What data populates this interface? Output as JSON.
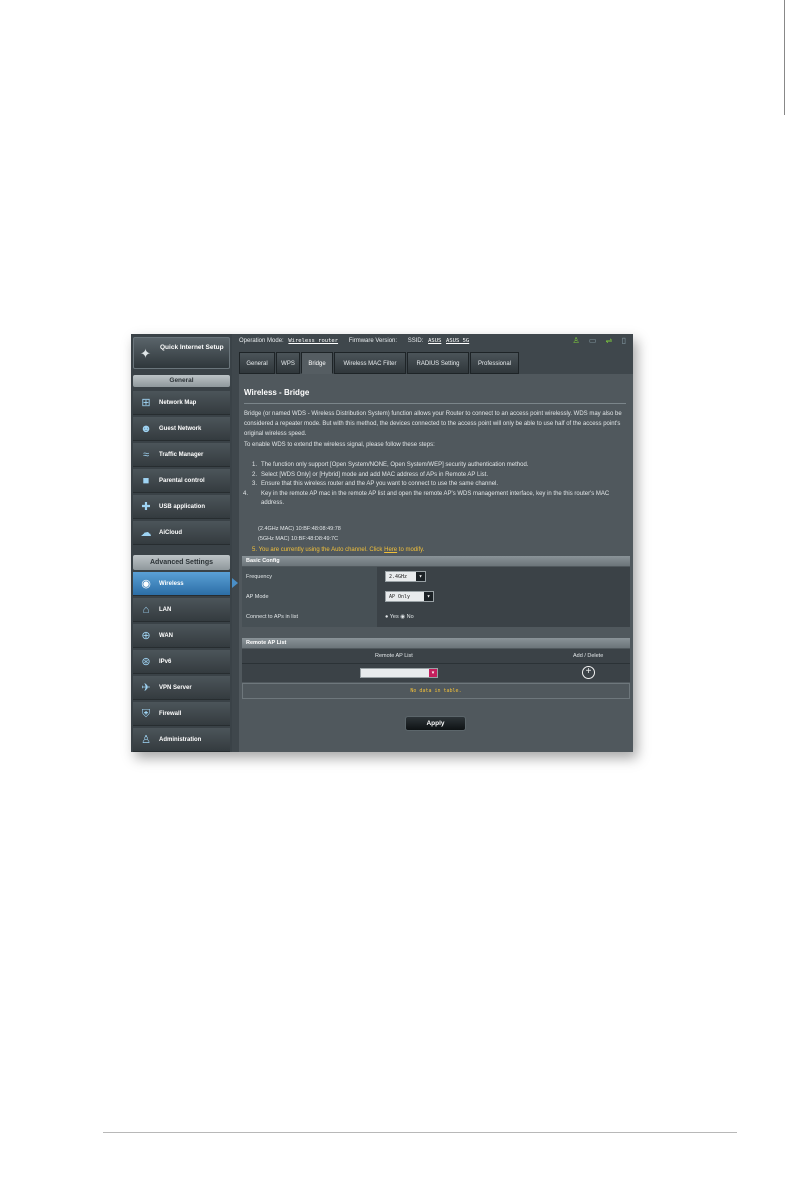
{
  "sidebar": {
    "quick_setup": "Quick Internet Setup",
    "general_header": "General",
    "general_items": [
      {
        "label": "Network Map"
      },
      {
        "label": "Guest Network"
      },
      {
        "label": "Traffic Manager"
      },
      {
        "label": "Parental control"
      },
      {
        "label": "USB application"
      },
      {
        "label": "AiCloud"
      }
    ],
    "advanced_header": "Advanced Settings",
    "advanced_items": [
      {
        "label": "Wireless"
      },
      {
        "label": "LAN"
      },
      {
        "label": "WAN"
      },
      {
        "label": "IPv6"
      },
      {
        "label": "VPN Server"
      },
      {
        "label": "Firewall"
      },
      {
        "label": "Administration"
      }
    ],
    "active_item": "Wireless"
  },
  "topbar": {
    "mode_label": "Operation Mode:",
    "mode_value": "Wireless router",
    "firmware_label": "Firmware Version:",
    "ssid_label": "SSID:",
    "ssid_1": "ASUS",
    "ssid_2": "ASUS_5G"
  },
  "tabs": [
    "General",
    "WPS",
    "Bridge",
    "Wireless MAC Filter",
    "RADIUS Setting",
    "Professional"
  ],
  "active_tab": "Bridge",
  "page": {
    "title": "Wireless - Bridge",
    "description_1": "Bridge (or named WDS - Wireless Distribution System) function allows your Router to connect to an access point wirelessly. WDS may also be considered a repeater mode. But with this method, the devices connected to the access point will only be able to use half of the access point's original wireless speed.",
    "description_2": "To enable WDS to extend the wireless signal, please follow these steps:",
    "steps": [
      {
        "num": "1.",
        "text": "The function only support [Open System/NONE, Open System/WEP] security authentication method."
      },
      {
        "num": "2.",
        "text": "Select [WDS Only] or [Hybrid] mode and add MAC address of APs in Remote AP List."
      },
      {
        "num": "3.",
        "text": "Ensure that this wireless router and the AP you want to connect to use the same channel."
      },
      {
        "num": "4.",
        "text": "Key in the remote AP mac in the remote AP list and open the remote AP's WDS management interface, key in the this router's MAC address."
      }
    ],
    "mac_24": "(2.4GHz MAC) 10:BF:48:08:49:78",
    "mac_5": "(5GHz MAC) 10:BF:48:D8:49:7C",
    "note_num": "5.",
    "note_pre": "You are currently using the Auto channel. Click",
    "note_link": "Here",
    "note_post": "to modify."
  },
  "basic_config": {
    "header": "Basic Config",
    "frequency_label": "Frequency",
    "frequency_value": "2.4GHz",
    "ap_mode_label": "AP Mode",
    "ap_mode_value": "AP Only",
    "connect_label": "Connect to APs in list",
    "yes_label": "Yes",
    "no_label": "No",
    "connect_value": "No"
  },
  "remote_ap": {
    "header": "Remote AP List",
    "col_list": "Remote AP List",
    "col_action": "Add / Delete",
    "empty_text": "No data in table."
  },
  "apply_label": "Apply"
}
